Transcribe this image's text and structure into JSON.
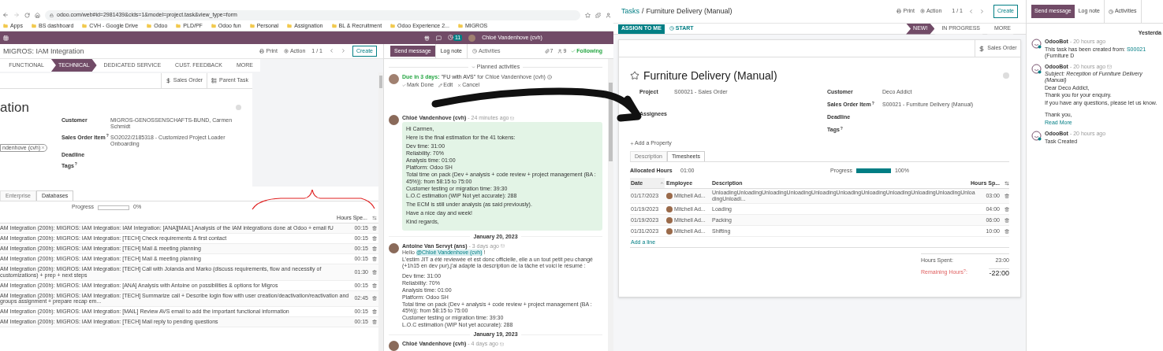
{
  "left_screen": {
    "browser": {
      "url": "odoo.com/web#id=2981439&cids=1&model=project.task&view_type=form",
      "bookmarks": [
        "Apps",
        "BS dashboard",
        "CVH - Google Drive",
        "Odoo",
        "PLD/PF",
        "Odoo fun",
        "Personal",
        "Assignation",
        "BL & Recruitment",
        "Odoo Experience 2...",
        "MIGROS"
      ]
    },
    "top_bar": {
      "badge": "11",
      "user": "Chloé Vandenhove (cvh)"
    },
    "form": {
      "breadcrumb": "MIGROS: IAM Integration",
      "print": "Print",
      "action": "Action",
      "pager": "1 / 1",
      "create": "Create",
      "stages": [
        {
          "label": "FUNCTIONAL",
          "selected": false
        },
        {
          "label": "TECHNICAL",
          "selected": true
        },
        {
          "label": "DEDICATED SERVICE",
          "selected": false
        },
        {
          "label": "CUST. FEEDBACK",
          "selected": false
        },
        {
          "label": "MORE",
          "selected": false
        }
      ],
      "smart_buttons": [
        "Sales Order",
        "Parent Task"
      ],
      "title": "ation",
      "assignee_tag": "ndenhove (cvh)",
      "fields": [
        {
          "label": "Customer",
          "value": "MIGROS-GENOSSENSCHAFTS-BUND, Carmen Schmidt"
        },
        {
          "label": "Sales Order Item",
          "help": "?",
          "value": "SO2022/2185318 - Customized Project Loader Onboarding"
        },
        {
          "label": "Deadline"
        },
        {
          "label": "Tags",
          "help": "?"
        }
      ],
      "tabs": [
        {
          "label": "Enterprise",
          "selected": false
        },
        {
          "label": "Databases",
          "selected": true
        }
      ],
      "progress": {
        "label": "Progress",
        "level": 0,
        "reading": "0%"
      },
      "table": {
        "columns": [
          "Hours Spe..."
        ],
        "rows": [
          {
            "description": "AM Integration (200h): MIGROS: IAM Integration: IAM Integration: [ANA][MAIL] Analysis of the IAM integrations done at Odoo + email fU",
            "hours": "00:15"
          },
          {
            "description": "AM Integration (200h): MIGROS: IAM Integration: [TECH] Check requirements & first contact",
            "hours": "00:15"
          },
          {
            "description": "AM Integration (200h): MIGROS: IAM Integration: [TECH] Mail & meeting planning",
            "hours": "00:15"
          },
          {
            "description": "AM Integration (200h): MIGROS: IAM Integration: [TECH] Mail & meeting planning",
            "hours": "00:15"
          },
          {
            "description": "AM Integration (200h): MIGROS: IAM Integration: [TECH] Call with Jolanda and Marko (discuss requirements, flow and necessity of customizations) + prep + next steps",
            "hours": "01:30"
          },
          {
            "description": "AM Integration (200h): MIGROS: IAM Integration: [ANA] Analysis with Antoine on possibilities & options for Migros",
            "hours": "00:15"
          },
          {
            "description": "AM Integration (200h): MIGROS: IAM Integration: [TECH] Summarize call + Describe login flow with user creation/deactivation/reactivation and groups assignment + prepare recap em...",
            "hours": "02:45"
          },
          {
            "description": "AM Integration (200h): MIGROS: IAM Integration: [MAIL] Review AVS email to add the important functional information",
            "hours": "00:15"
          },
          {
            "description": "AM Integration (200h): MIGROS: IAM Integration: [TECH] Mail reply to pending questions",
            "hours": "00:15"
          }
        ]
      }
    },
    "chatter": {
      "send": "Send message",
      "tabs": [
        {
          "label": "Log note",
          "selected": true
        },
        {
          "label": "Activities",
          "selected": false
        }
      ],
      "attachments": "7",
      "followers": "9",
      "following": "Following",
      "planned_title": "Planned activities",
      "activity": {
        "due": "Due in 3 days:",
        "summary": "\"FU with AVS\"",
        "assignee": "for Chloé Vandenhove (cvh)",
        "actions": [
          "Mark Done",
          "Edit",
          "Cancel"
        ]
      },
      "messages": [
        {
          "kind": "email",
          "author": "Chloé Vandenhove (cvh)",
          "time": "- 24 minutes ago",
          "lines": [
            "Hi Carmen,",
            "Here is the final estimation for the 41 tokens:",
            "Dev time: 31:00",
            "Reliability: 70%",
            "Analysis time: 01:00",
            "Platform: Odoo SH",
            "Total time on pack (Dev + analysis + code review + project management (BA : 45%)): from 58:15 to 75:00",
            "Customer testing or migration time: 39:30",
            "L.O.C estimation (WIP Not yet accurate): 288",
            "The ECM is still under analysis (as said previously).",
            "Have a nice day and week!",
            "Kind regards,"
          ]
        },
        {
          "kind": "date",
          "label": "January 20, 2023"
        },
        {
          "kind": "message",
          "author": "Antoine Van Servyt (ans)",
          "time": "- 3 days ago",
          "mention_line": {
            "before": "Hello",
            "mention": "@Chloé Vandenhove (cvh)",
            "after": "!"
          },
          "lines": [
            "L'estim JIT a été reviewée et est donc officielle, elle a un tout petit peu changé (+1h15 en dev pur),j'ai adapté la description de la tâche et voici le résumé :",
            "Dev time: 31:00",
            "Reliability: 70%",
            "Analysis time: 01:00",
            "Platform: Odoo SH",
            "Total time on pack (Dev + analysis + code review + project management (BA : 45%)): from 58:15 to 75:00",
            "Customer testing or migration time: 39:30",
            "L.O.C estimation (WIP Not yet accurate): 288"
          ]
        },
        {
          "kind": "date",
          "label": "January 19, 2023"
        },
        {
          "kind": "message",
          "author": "Chloé Vandenhove (cvh)",
          "time": "- 4 days ago"
        }
      ]
    }
  },
  "right_screen": {
    "breadcrumb": [
      "Tasks",
      "Furniture Delivery (Manual)"
    ],
    "separator": "/",
    "print": "Print",
    "action": "Action",
    "pager": "1 / 1",
    "create": "Create",
    "buttons": [
      "ASSIGN TO ME",
      "START"
    ],
    "stages": [
      {
        "label": "NEW!",
        "selected": true
      },
      {
        "label": "IN PROGRESS",
        "selected": false
      },
      {
        "label": "MORE",
        "selected": false
      }
    ],
    "smart_buttons": [
      "Sales Order"
    ],
    "title": "Furniture Delivery (Manual)",
    "starred": false,
    "left_fields": [
      {
        "label": "Project",
        "value": "S00021 - Sales Order"
      },
      {
        "label": "Assignees"
      }
    ],
    "right_fields": [
      {
        "label": "Customer",
        "value": "Deco Addict"
      },
      {
        "label": "Sales Order Item",
        "help": "?",
        "value": "S00021 - Furniture Delivery (Manual)"
      },
      {
        "label": "Deadline"
      },
      {
        "label": "Tags",
        "help": "?"
      }
    ],
    "add_property": "Add a Property",
    "tabs": [
      {
        "label": "Description",
        "selected": false
      },
      {
        "label": "Timesheets",
        "selected": true
      }
    ],
    "allocated": {
      "label": "Allocated Hours",
      "value": "01:00"
    },
    "progress": {
      "label": "Progress",
      "level": 1,
      "reading": "100%"
    },
    "timesheet": {
      "columns": [
        "Date",
        "Employee",
        "Description",
        "Hours Sp..."
      ],
      "rows": [
        {
          "date": "01/17/2023",
          "employee": "Mitchell Ad...",
          "description": "UnloadingUnloadingUnloadingUnloadingUnloadingUnloadingUnloadingUnloadingUnloadingUnloadingUnloadingUnloadi...",
          "hours": "03:00"
        },
        {
          "date": "01/19/2023",
          "employee": "Mitchell Ad...",
          "description": "Loading",
          "hours": "04:00"
        },
        {
          "date": "01/19/2023",
          "employee": "Mitchell Ad...",
          "description": "Packing",
          "hours": "06:00"
        },
        {
          "date": "01/31/2023",
          "employee": "Mitchell Ad...",
          "description": "Shifting",
          "hours": "10:00"
        }
      ],
      "add_line": "Add a line",
      "totals": [
        {
          "kind": "normal",
          "label": "Hours Spent:",
          "value": "23:00"
        },
        {
          "kind": "alert",
          "label": "Remaining Hours",
          "help": "?",
          "suffix": ":",
          "value": "-22:00"
        }
      ]
    },
    "chatter": {
      "send": "Send message",
      "tabs": [
        {
          "label": "Log note",
          "selected": false
        },
        {
          "label": "Activities",
          "selected": false
        }
      ],
      "date": "Yesterda",
      "messages": [
        {
          "author": "OdooBot",
          "time": "- 20 hours ago",
          "mail": false,
          "text": "This task has been created from:",
          "link": "S00021",
          "text_after": "(Furniture D"
        },
        {
          "author": "OdooBot",
          "time": "- 20 hours ago",
          "mail": true,
          "subject": "Subject: Reception of Furniture Delivery (Manual)",
          "lines": [
            "Dear Deco Addict,",
            "Thank you for your enquiry.",
            "If you have any questions, please let us know.",
            "Thank you,"
          ],
          "read_more": "Read More"
        },
        {
          "author": "OdooBot",
          "time": "- 20 hours ago",
          "mail": false,
          "lines": [
            "Task Created"
          ]
        }
      ]
    }
  }
}
